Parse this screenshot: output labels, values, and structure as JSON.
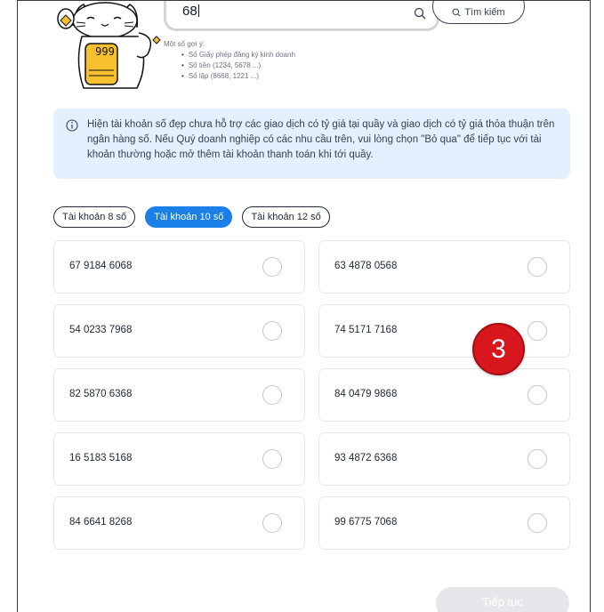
{
  "search": {
    "value": "68",
    "button_label": "Tìm kiếm"
  },
  "suggestions": {
    "heading": "Một số gợi ý:",
    "items": [
      "Số Giấy phép đăng ký kinh doanh",
      "Số tiền (1234, 5678 ...)",
      "Số lặp (8668, 1221 ...)"
    ]
  },
  "mascot": {
    "plate_text": "999"
  },
  "info": {
    "text": "Hiện tài khoản số đẹp chưa hỗ trợ các giao dịch có tỷ giá tại quầy và giao dịch có tỷ giá thỏa thuận trên ngân hàng số. Nếu Quý doanh nghiệp có các nhu cầu trên, vui lòng chọn \"Bỏ qua\" để tiếp tục với tài khoản thường hoặc mở thêm tài khoản thanh toán khi tới quầy."
  },
  "tabs": [
    {
      "label": "Tài khoản 8 số",
      "active": false
    },
    {
      "label": "Tài khoản 10 số",
      "active": true
    },
    {
      "label": "Tài khoản 12 số",
      "active": false
    }
  ],
  "accounts": [
    "67 9184 6068",
    "63 4878 0568",
    "54 0233 7968",
    "74 5171 7168",
    "82 5870 6368",
    "84 0479 9868",
    "16 5183 5168",
    "93 4872 6368",
    "84 6641 8268",
    "99 6775 7068"
  ],
  "badge": {
    "text": "3"
  },
  "footer": {
    "continue_label": "Tiếp tục"
  },
  "colors": {
    "primary": "#1a7fe6",
    "info_bg": "#e4f0fd",
    "badge": "#d7161d",
    "disabled": "#e5e7eb"
  }
}
